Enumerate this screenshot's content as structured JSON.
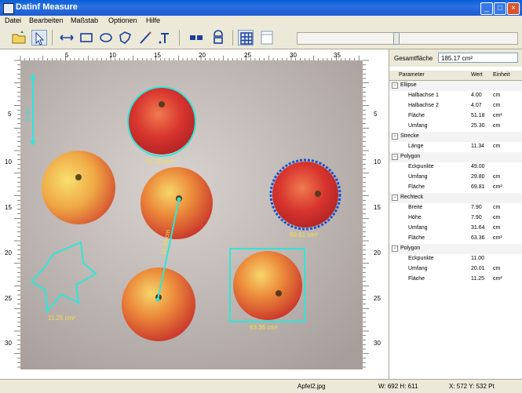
{
  "window": {
    "title": "Datinf Measure",
    "minimize": "_",
    "maximize": "□",
    "close": "×"
  },
  "menu": [
    "Datei",
    "Bearbeiten",
    "Maßstab",
    "Optionen",
    "Hilfe"
  ],
  "ruler": {
    "top_ticks": [
      "5",
      "10",
      "15",
      "20",
      "25",
      "30",
      "35"
    ],
    "left_ticks": [
      "5",
      "10",
      "15",
      "20",
      "25",
      "30"
    ],
    "right_ticks": [
      "5",
      "10",
      "15",
      "20",
      "25",
      "30"
    ]
  },
  "annotations": {
    "apple_top": "51.18 cm²",
    "apple_right": "69.81 cm²",
    "apple_bottom_right": "63.36 cm²",
    "polygon": "11.25 cm²",
    "line": "11.34 cm",
    "scale": "6 cm"
  },
  "panel": {
    "total_label": "Gesamtfläche",
    "total_value": "185.17 cm²",
    "headers": [
      "Parameter",
      "Wert",
      "Einheit"
    ],
    "groups": [
      {
        "name": "Ellipse",
        "rows": [
          [
            "Halbachse 1",
            "4.00",
            "cm"
          ],
          [
            "Halbachse 2",
            "4.07",
            "cm"
          ],
          [
            "Fläche",
            "51.18",
            "cm²"
          ],
          [
            "Umfang",
            "25.30",
            "cm"
          ]
        ]
      },
      {
        "name": "Strecke",
        "rows": [
          [
            "Länge",
            "11.34",
            "cm"
          ]
        ]
      },
      {
        "name": "Polygon",
        "rows": [
          [
            "Eckpunkte",
            "49.00",
            ""
          ],
          [
            "Umfang",
            "29.80",
            "cm"
          ],
          [
            "Fläche",
            "69.81",
            "cm²"
          ]
        ]
      },
      {
        "name": "Rechteck",
        "rows": [
          [
            "Breite",
            "7.90",
            "cm"
          ],
          [
            "Höhe",
            "7.90",
            "cm"
          ],
          [
            "Umfang",
            "31.64",
            "cm"
          ],
          [
            "Fläche",
            "63.36",
            "cm²"
          ]
        ]
      },
      {
        "name": "Polygon",
        "rows": [
          [
            "Eckpunkte",
            "11.00",
            ""
          ],
          [
            "Umfang",
            "20.01",
            "cm"
          ],
          [
            "Fläche",
            "11.25",
            "cm²"
          ]
        ]
      }
    ]
  },
  "status": {
    "file": "Apfel2.jpg",
    "dimensions": "W: 692  H: 611",
    "cursor": "X: 572  Y: 532 Pt"
  },
  "zoom": {
    "level": 0.45
  },
  "colors": {
    "accent": "#2ee6d8",
    "label": "#f2e04a",
    "title_bar": "#0a5fd8"
  }
}
